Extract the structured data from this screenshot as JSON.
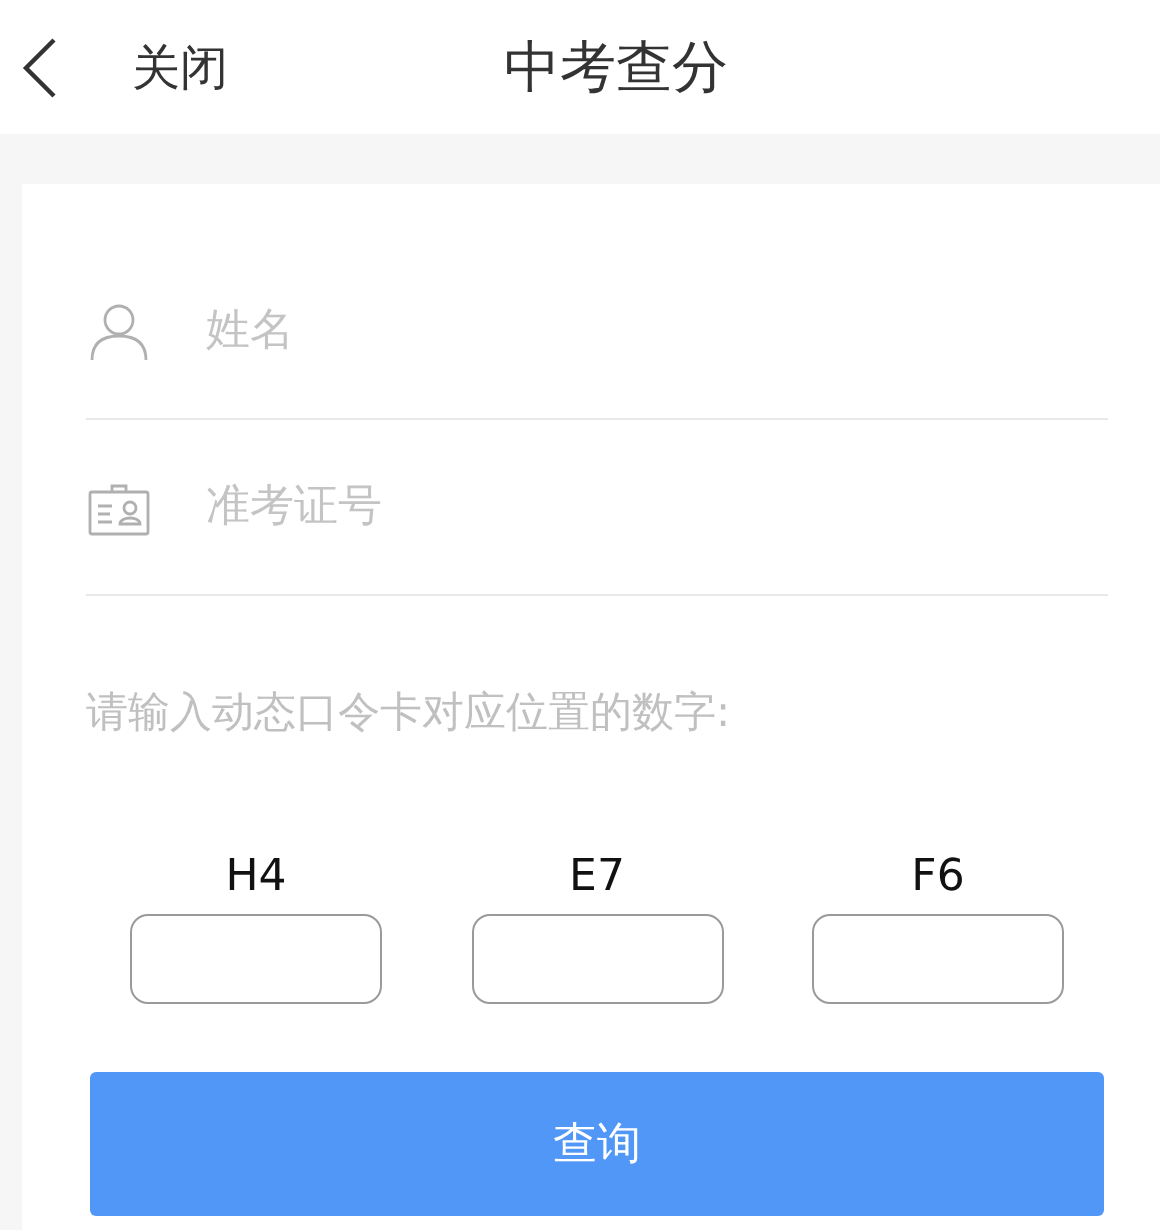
{
  "header": {
    "back": "关闭",
    "title": "中考查分"
  },
  "fields": [
    {
      "kind": "person",
      "placeholder": "姓名"
    },
    {
      "kind": "idcard",
      "placeholder": "准考证号"
    }
  ],
  "prompt": "请输入动态口令卡对应位置的数字:",
  "codes": [
    {
      "label": "H4"
    },
    {
      "label": "E7"
    },
    {
      "label": "F6"
    }
  ],
  "button": "查询"
}
